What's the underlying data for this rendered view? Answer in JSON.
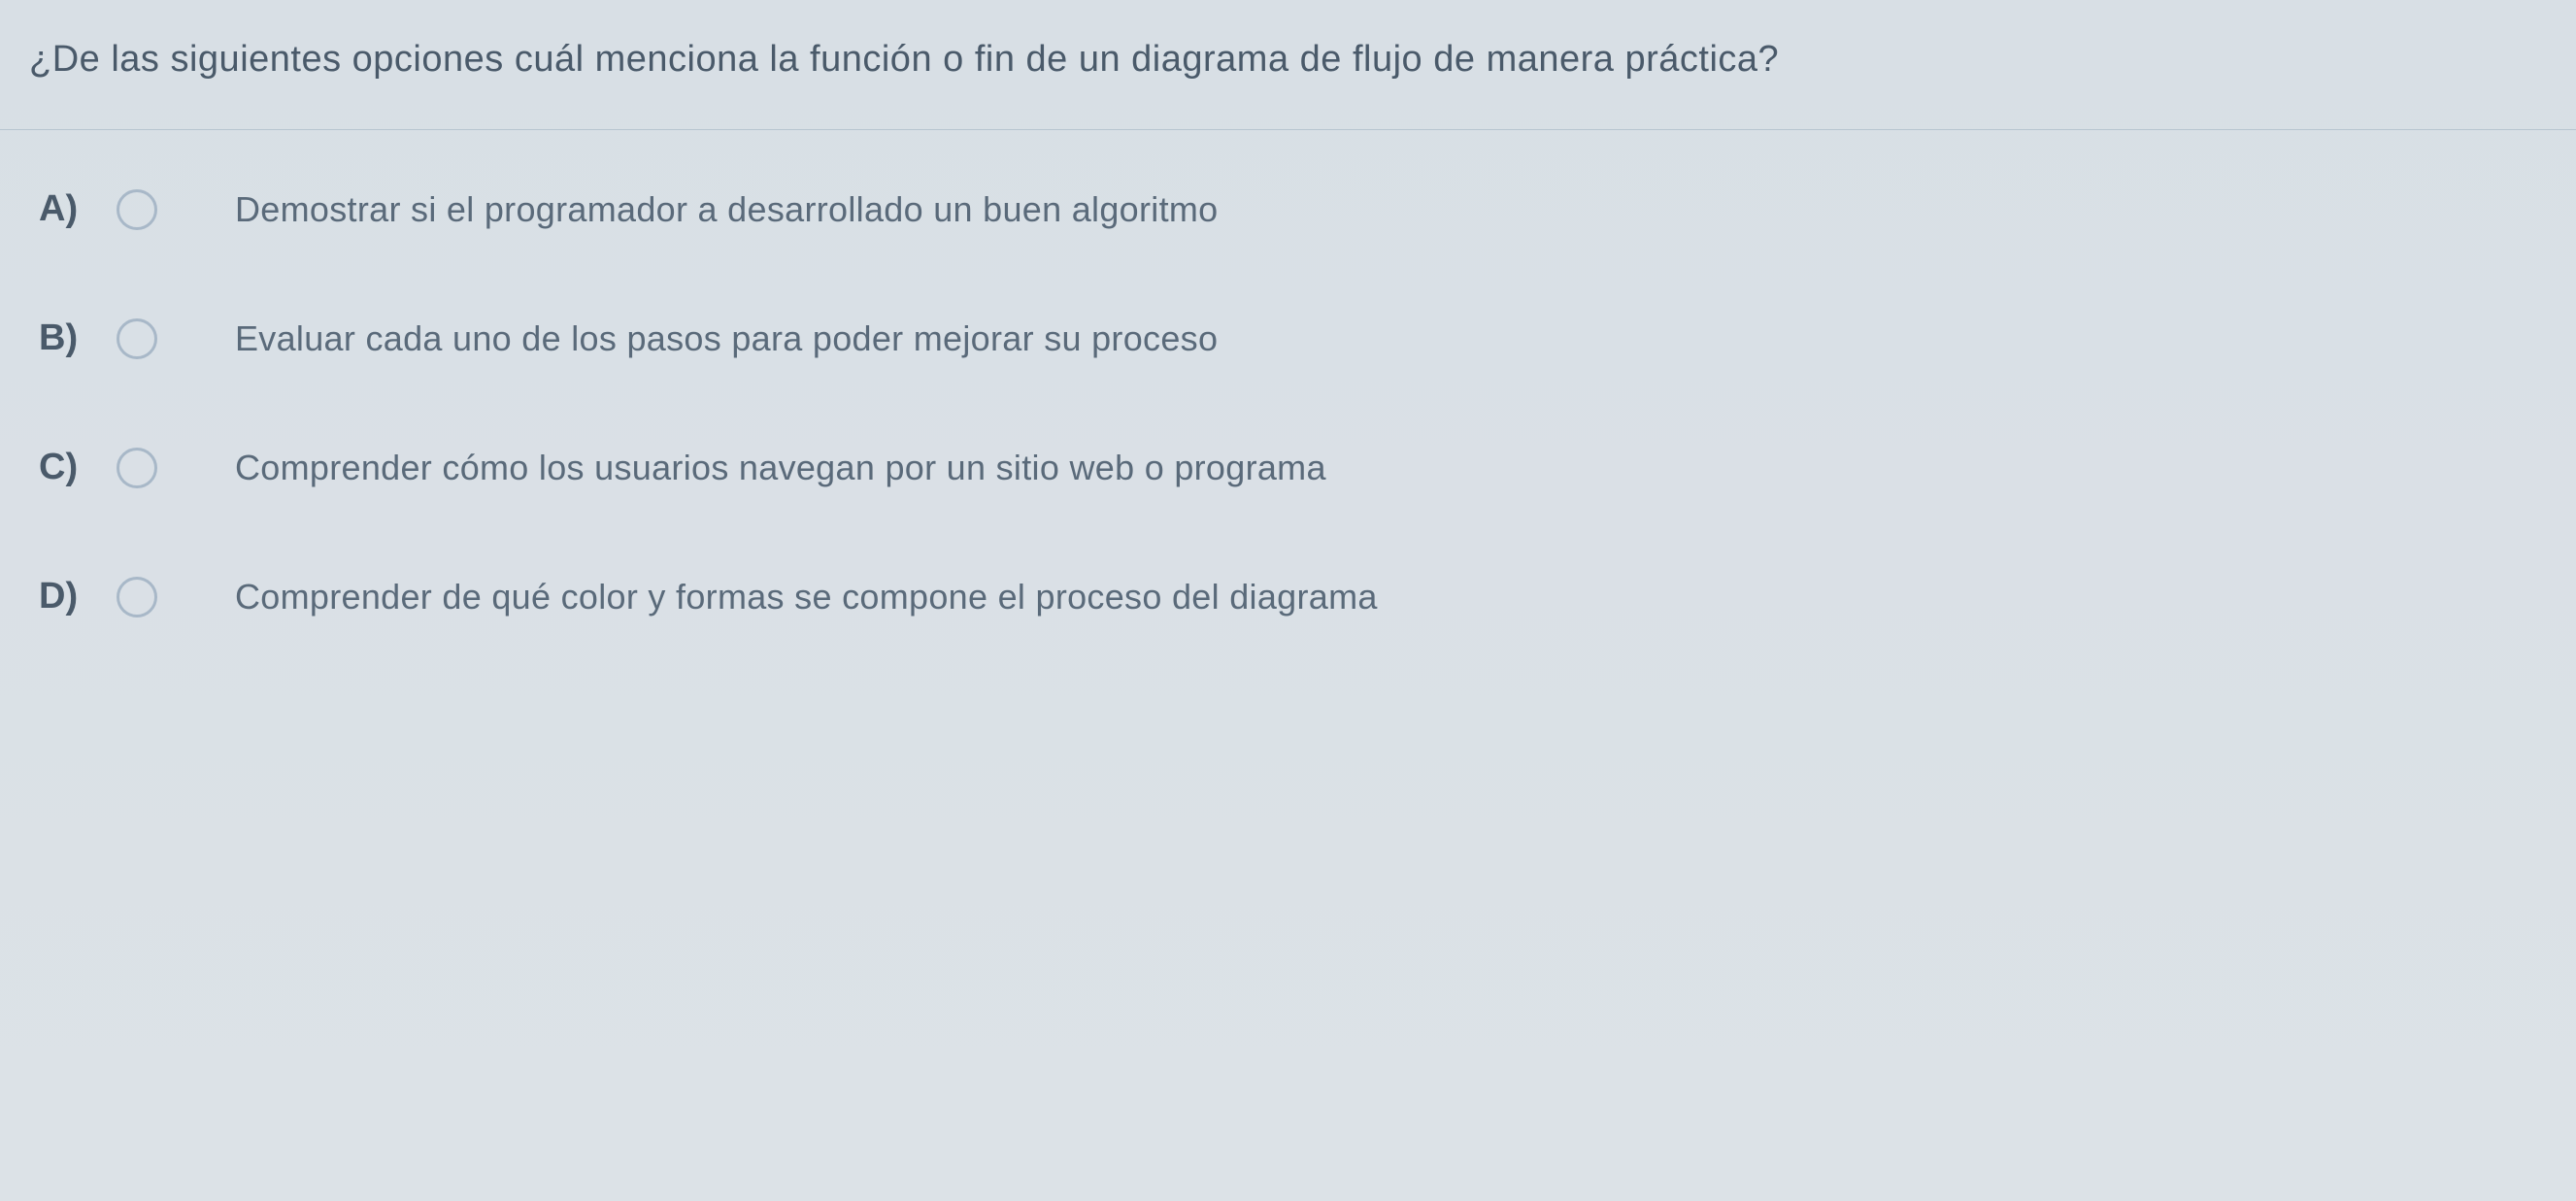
{
  "question": {
    "text": "¿De las siguientes opciones cuál menciona la función o fin de un diagrama de flujo de manera práctica?"
  },
  "options": [
    {
      "label": "A)",
      "text": "Demostrar si el programador a desarrollado un buen algoritmo"
    },
    {
      "label": "B)",
      "text": "Evaluar cada uno de los pasos para poder mejorar su proceso"
    },
    {
      "label": "C)",
      "text": "Comprender cómo los usuarios navegan por un sitio web o programa"
    },
    {
      "label": "D)",
      "text": "Comprender de qué color y formas se compone el proceso del diagrama"
    }
  ]
}
